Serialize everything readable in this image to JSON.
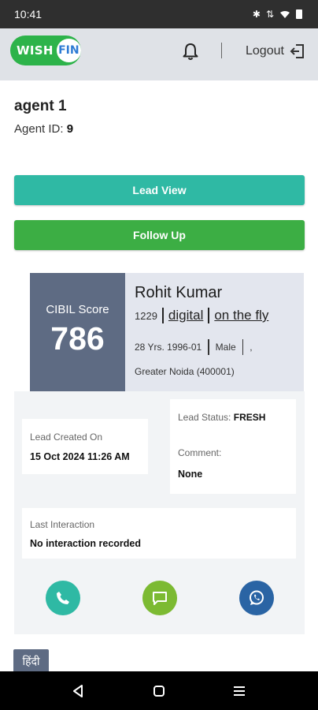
{
  "status_bar": {
    "time": "10:41",
    "icons": [
      "bluetooth-icon",
      "data-icon",
      "wifi-icon",
      "battery-icon"
    ]
  },
  "header": {
    "logo": {
      "wish": "WISH",
      "fin": "FIN"
    },
    "logout_label": "Logout",
    "colors": {
      "header_bg": "#dfe2e7",
      "logo_green": "#2db34a",
      "logo_blue": "#2d7bd4"
    }
  },
  "agent": {
    "name": "agent 1",
    "id_label": "Agent ID:",
    "id_value": "9"
  },
  "buttons": {
    "lead_view": "Lead View",
    "follow_up": "Follow Up"
  },
  "lead_card": {
    "cibil_label": "CIBIL Score",
    "cibil_score": "786",
    "name": "Rohit Kumar",
    "lead_id": "1229",
    "source": "digital",
    "mode": "on the fly",
    "age": "28 Yrs. 1996-01",
    "gender": "Male",
    "comma": ",",
    "location": "Greater Noida (400001)"
  },
  "details": {
    "lead_created_label": "Lead Created On",
    "lead_created_value": "15 Oct 2024 11:26 AM",
    "lead_status_label": "Lead Status:",
    "lead_status_value": "FRESH",
    "comment_label": "Comment:",
    "comment_value": "None",
    "last_interaction_label": "Last Interaction",
    "last_interaction_value": "No interaction recorded"
  },
  "actions": [
    "phone-icon",
    "message-icon",
    "whatsapp-icon"
  ],
  "language_button": "हिंदी",
  "nav": [
    "back-icon",
    "home-icon",
    "recents-icon"
  ]
}
